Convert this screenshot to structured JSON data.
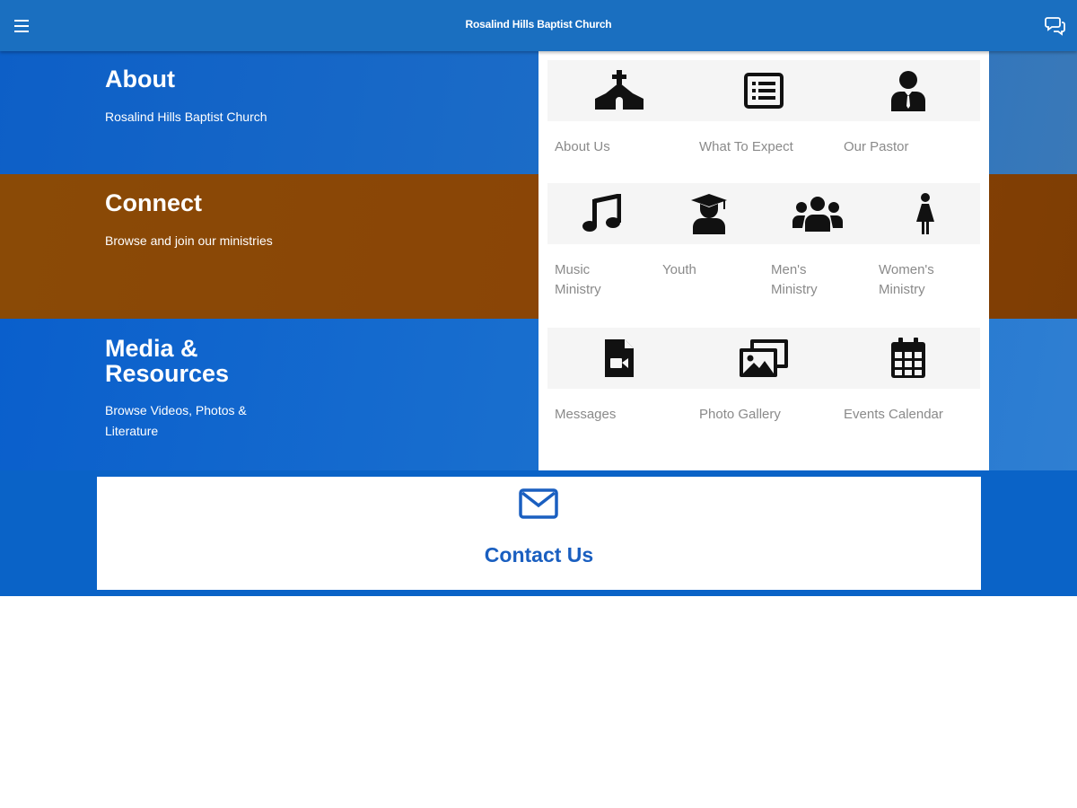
{
  "app_bar": {
    "title": "Rosalind Hills Baptist Church",
    "menu_icon": "hamburger-menu-icon",
    "chat_icon": "chat-bubbles-icon"
  },
  "sections": {
    "about": {
      "heading": "About",
      "subtitle": "Rosalind Hills Baptist Church",
      "tiles": [
        {
          "label": "About Us",
          "icon": "church-icon"
        },
        {
          "label": "What To Expect",
          "icon": "list-icon"
        },
        {
          "label": "Our Pastor",
          "icon": "pastor-icon"
        }
      ]
    },
    "connect": {
      "heading": "Connect",
      "subtitle": "Browse and join our ministries",
      "tiles": [
        {
          "label": "Music Ministry",
          "icon": "music-note-icon"
        },
        {
          "label": "Youth",
          "icon": "graduate-icon"
        },
        {
          "label": "Men's Ministry",
          "icon": "group-icon"
        },
        {
          "label": "Women's Ministry",
          "icon": "woman-icon"
        }
      ]
    },
    "media": {
      "heading": "Media & Resources",
      "subtitle": "Browse Videos, Photos & Literature",
      "tiles": [
        {
          "label": "Messages",
          "icon": "video-file-icon"
        },
        {
          "label": "Photo Gallery",
          "icon": "photo-gallery-icon"
        },
        {
          "label": "Events Calendar",
          "icon": "calendar-icon"
        }
      ]
    }
  },
  "contact": {
    "label": "Contact Us",
    "icon": "envelope-icon"
  },
  "colors": {
    "app_bar": "#1a6fc0",
    "about_bg": "#0d5fc7",
    "connect_bg": "#8a4a06",
    "media_bg": "#0a5fcc",
    "contact_text": "#1a5fc0"
  }
}
